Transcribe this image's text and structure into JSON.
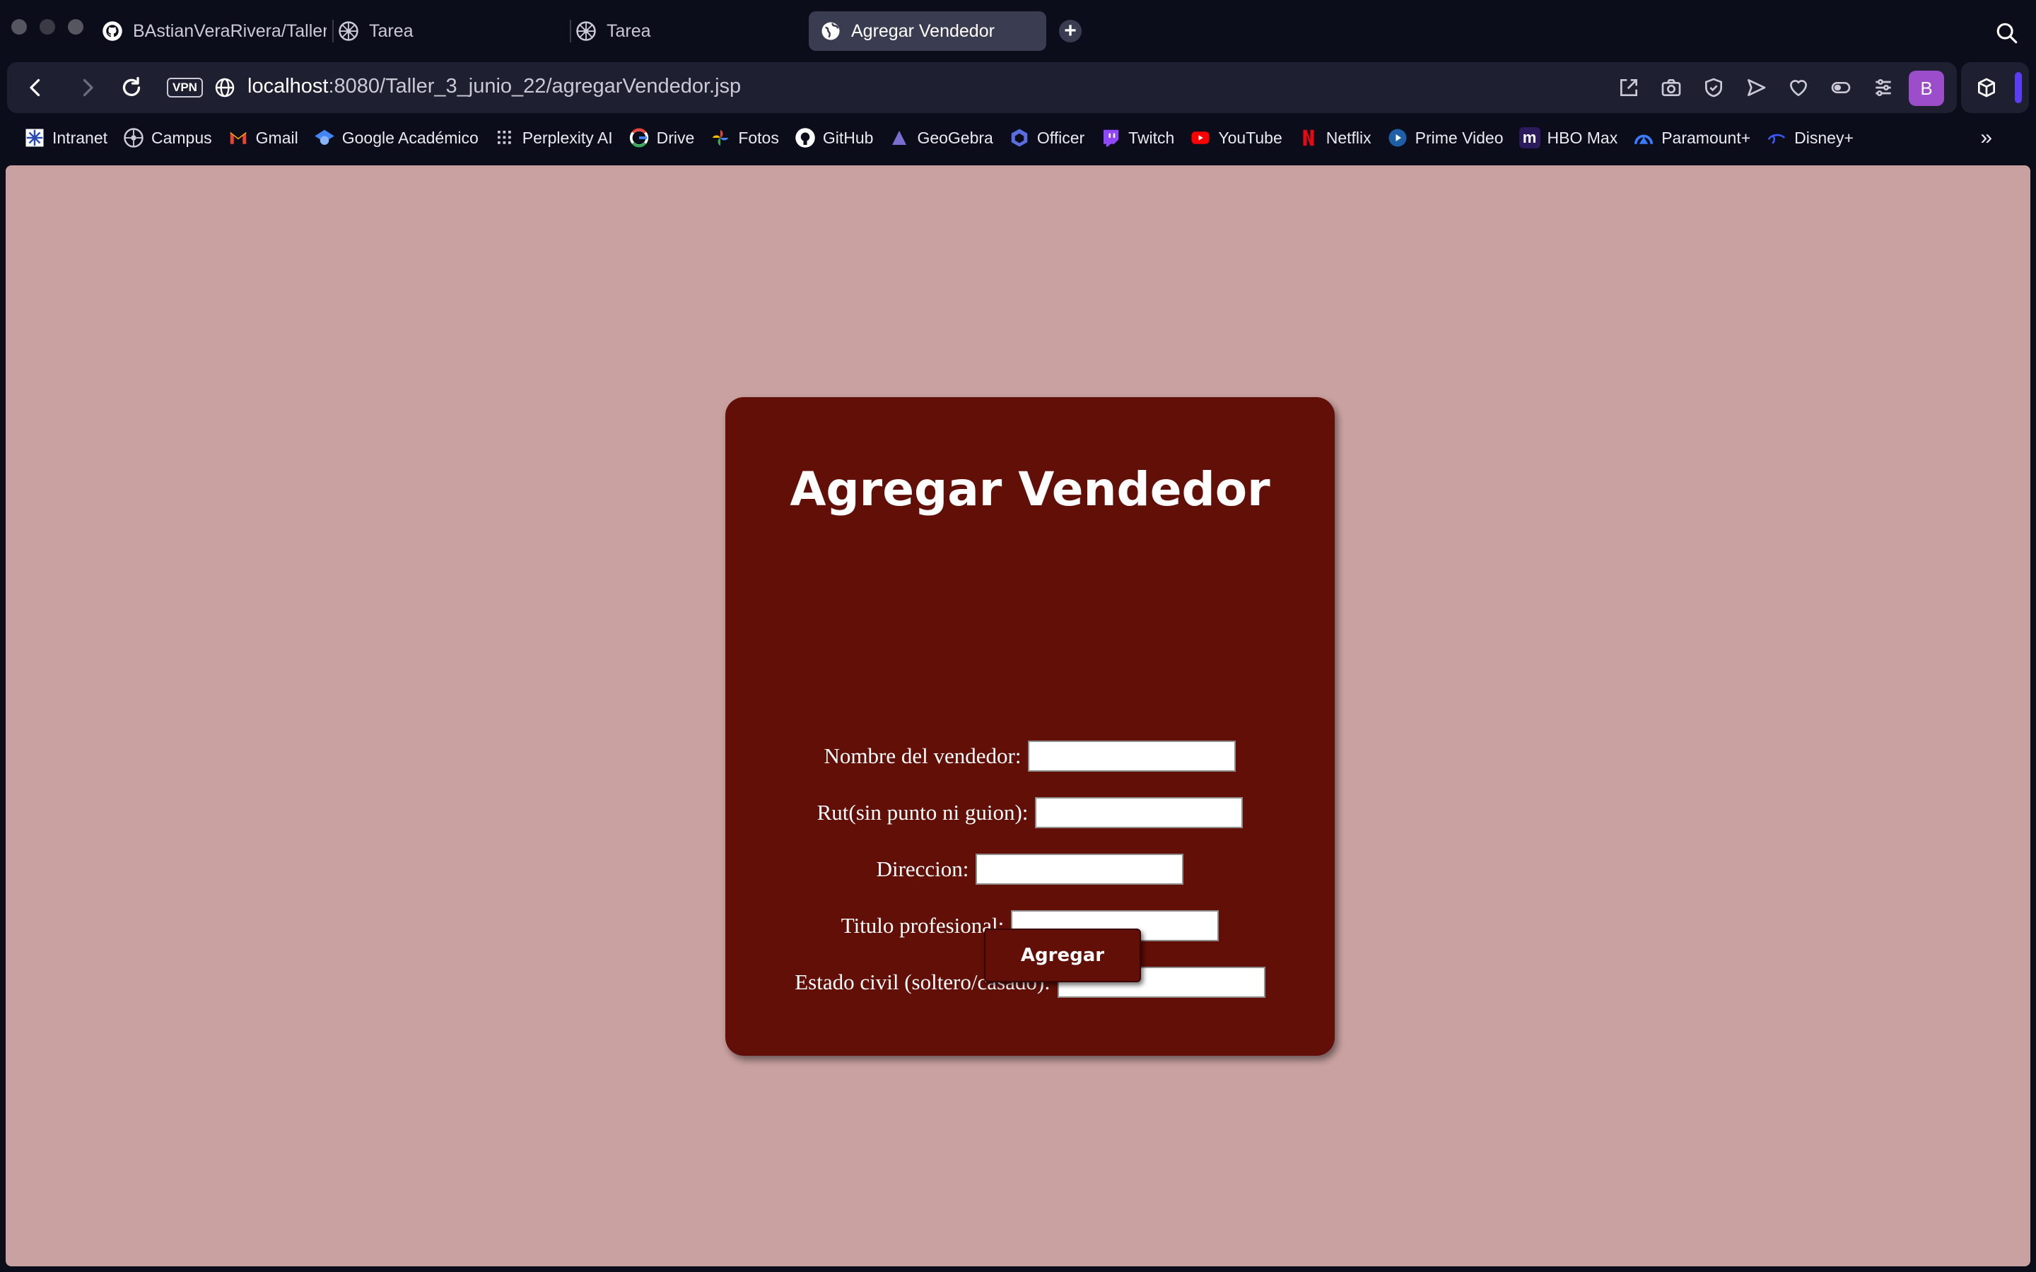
{
  "browser": {
    "tabs": [
      {
        "title": "BAstianVeraRivera/Taller",
        "icon": "github-icon"
      },
      {
        "title": "Tarea",
        "icon": "campus-icon"
      },
      {
        "title": "Tarea",
        "icon": "campus-icon"
      },
      {
        "title": "Agregar Vendedor",
        "icon": "globe-icon",
        "active": true
      }
    ],
    "new_tab_label": "+",
    "vpn_label": "VPN",
    "url_host": "localhost",
    "url_rest": ":8080/Taller_3_junio_22/agregarVendedor.jsp",
    "profile_initial": "B",
    "bookmarks": [
      {
        "label": "Intranet",
        "icon": "intranet-icon"
      },
      {
        "label": "Campus",
        "icon": "campus-icon"
      },
      {
        "label": "Gmail",
        "icon": "gmail-icon"
      },
      {
        "label": "Google Académico",
        "icon": "scholar-icon"
      },
      {
        "label": "Perplexity AI",
        "icon": "perplexity-icon"
      },
      {
        "label": "Drive",
        "icon": "google-icon"
      },
      {
        "label": "Fotos",
        "icon": "photos-icon"
      },
      {
        "label": "GitHub",
        "icon": "github-icon"
      },
      {
        "label": "GeoGebra",
        "icon": "geogebra-icon"
      },
      {
        "label": "Officer",
        "icon": "officer-icon"
      },
      {
        "label": "Twitch",
        "icon": "twitch-icon"
      },
      {
        "label": "YouTube",
        "icon": "youtube-icon"
      },
      {
        "label": "Netflix",
        "icon": "netflix-icon"
      },
      {
        "label": "Prime Video",
        "icon": "prime-video-icon"
      },
      {
        "label": "HBO Max",
        "icon": "hbo-max-icon"
      },
      {
        "label": "Paramount+",
        "icon": "paramount-icon"
      },
      {
        "label": "Disney+",
        "icon": "disney-icon"
      }
    ],
    "bookmarks_more": "»"
  },
  "form": {
    "title": "Agregar Vendedor",
    "fields": [
      {
        "label": "Nombre del vendedor:",
        "value": ""
      },
      {
        "label": "Rut(sin punto ni guion):",
        "value": ""
      },
      {
        "label": "Direccion:",
        "value": ""
      },
      {
        "label": "Titulo profesional:",
        "value": ""
      },
      {
        "label": "Estado civil (soltero/casado):",
        "value": ""
      }
    ],
    "submit_label": "Agregar"
  },
  "colors": {
    "page_background": "#c9a1a1",
    "card_background": "#620f08",
    "browser_chrome": "#0b0d1a",
    "profile_accent": "#9b4dca"
  }
}
